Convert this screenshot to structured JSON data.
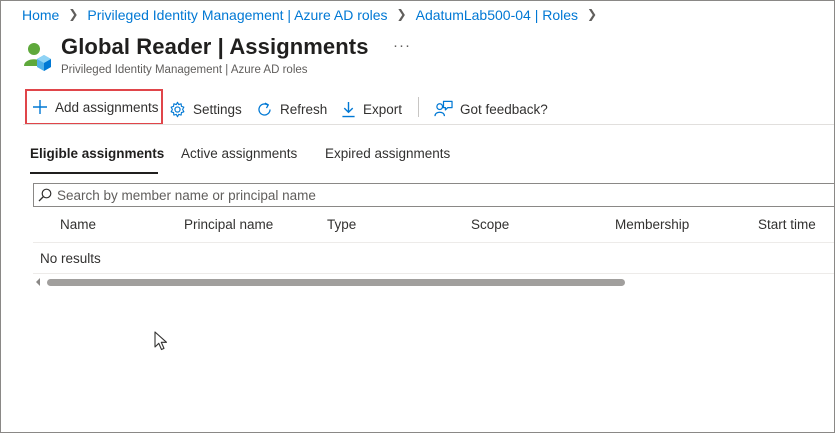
{
  "breadcrumb": [
    {
      "label": "Home"
    },
    {
      "label": "Privileged Identity Management | Azure AD roles"
    },
    {
      "label": "AdatumLab500-04 | Roles"
    }
  ],
  "header": {
    "title": "Global Reader | Assignments",
    "subtitle": "Privileged Identity Management | Azure AD roles",
    "more": "···",
    "icon": "user-role-icon"
  },
  "toolbar": {
    "add_label": "Add assignments",
    "settings_label": "Settings",
    "refresh_label": "Refresh",
    "export_label": "Export",
    "feedback_label": "Got feedback?"
  },
  "tabs": [
    {
      "label": "Eligible assignments",
      "active": true
    },
    {
      "label": "Active assignments",
      "active": false
    },
    {
      "label": "Expired assignments",
      "active": false
    }
  ],
  "search": {
    "placeholder": "Search by member name or principal name",
    "value": ""
  },
  "table": {
    "columns": [
      "Name",
      "Principal name",
      "Type",
      "Scope",
      "Membership",
      "Start time"
    ],
    "empty_text": "No results"
  },
  "colors": {
    "link": "#0078d4",
    "highlight": "#e0454a",
    "icon_blue": "#0078d4",
    "user_green": "#5ea83b"
  }
}
